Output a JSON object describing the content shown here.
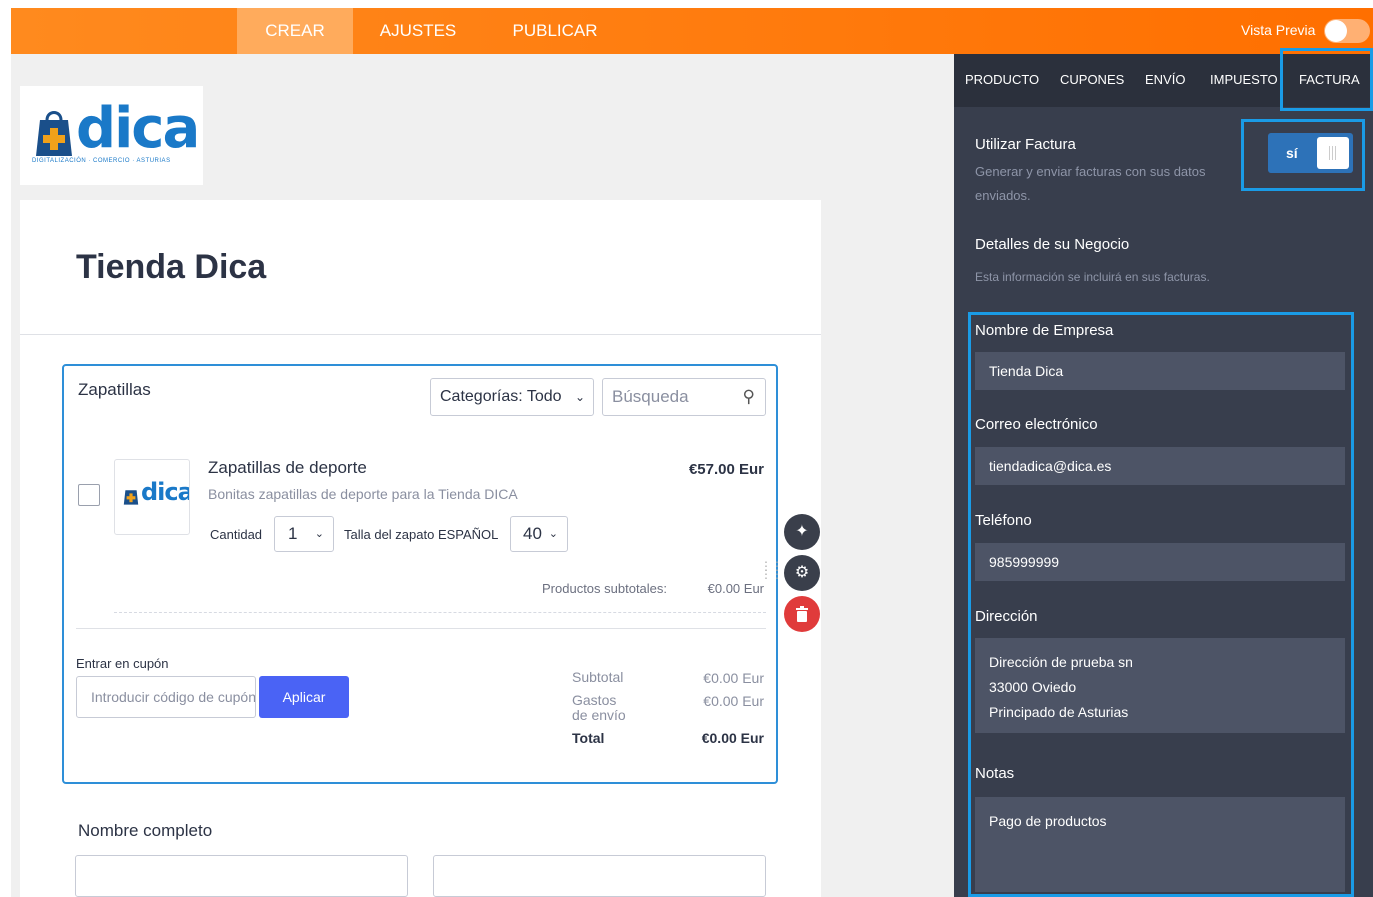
{
  "topbar": {
    "tabs": [
      "CREAR",
      "AJUSTES",
      "PUBLICAR"
    ],
    "preview_label": "Vista Previa"
  },
  "form": {
    "logo_text": "dica",
    "logo_subtitle": "DIGITALIZACIÓN · COMERCIO · ASTURIAS",
    "title": "Tienda Dica",
    "product_widget": {
      "label": "Zapatillas",
      "category_filter": "Categorías: Todo",
      "search_placeholder": "Búsqueda",
      "product": {
        "name": "Zapatillas de deporte",
        "price": "€57.00 Eur",
        "description": "Bonitas zapatillas de deporte para la Tienda DICA",
        "quantity_label": "Cantidad",
        "quantity": "1",
        "size_label": "Talla del zapato ESPAÑOL",
        "size": "40"
      },
      "subtotal_label": "Productos subtotales:",
      "subtotal_value": "€0.00 Eur",
      "coupon_label": "Entrar en cupón",
      "coupon_placeholder": "Introducir código de cupón",
      "apply_label": "Aplicar",
      "totals": {
        "subtotal_label": "Subtotal",
        "subtotal_value": "€0.00 Eur",
        "shipping_label": "Gastos de envío",
        "shipping_value": "€0.00 Eur",
        "total_label": "Total",
        "total_value": "€0.00 Eur"
      }
    },
    "fullname_label": "Nombre completo"
  },
  "panel": {
    "tabs": [
      "PRODUCTO",
      "CUPONES",
      "ENVÍO",
      "IMPUESTO",
      "FACTURA"
    ],
    "active_tab": "FACTURA",
    "use_invoice": {
      "title": "Utilizar Factura",
      "desc": "Generar y enviar facturas con sus datos enviados.",
      "toggle_label": "sí"
    },
    "business": {
      "title": "Detalles de su Negocio",
      "desc": "Esta información se incluirá en sus facturas."
    },
    "fields": {
      "company_label": "Nombre de Empresa",
      "company_value": "Tienda Dica",
      "email_label": "Correo electrónico",
      "email_value": "tiendadica@dica.es",
      "phone_label": "Teléfono",
      "phone_value": "985999999",
      "address_label": "Dirección",
      "address_lines": [
        "Dirección de prueba sn",
        "33000 Oviedo",
        "Principado de Asturias"
      ],
      "notes_label": "Notas",
      "notes_value": "Pago de productos"
    }
  },
  "colors": {
    "topbar": "#ff7a0f",
    "panel": "#383e4d",
    "highlight": "#1a9be6",
    "apply_button": "#4a63f5",
    "delete_button": "#e03b3b"
  }
}
